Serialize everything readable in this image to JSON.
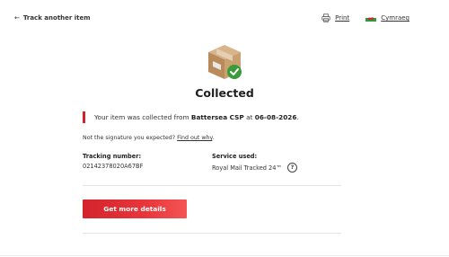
{
  "header": {
    "back_label": "Track another item",
    "print_label": "Print",
    "language_label": "Cymraeg"
  },
  "status": {
    "title": "Collected",
    "icon": "parcel-collected-icon"
  },
  "notice": {
    "prefix": "Your item was collected from ",
    "location": "Battersea CSP",
    "middle": " at ",
    "date": "06-08-2026",
    "suffix": "."
  },
  "signature": {
    "text": "Not the signature you expected? ",
    "link_label": "Find out why",
    "suffix": "."
  },
  "details": {
    "tracking_label": "Tracking number:",
    "tracking_value": "02142378020A67BF",
    "service_label": "Service used:",
    "service_value": "Royal Mail Tracked 24™"
  },
  "cta": {
    "label": "Get more details"
  },
  "colors": {
    "accent_red": "#d2232a",
    "success_green": "#3a9b3a"
  }
}
